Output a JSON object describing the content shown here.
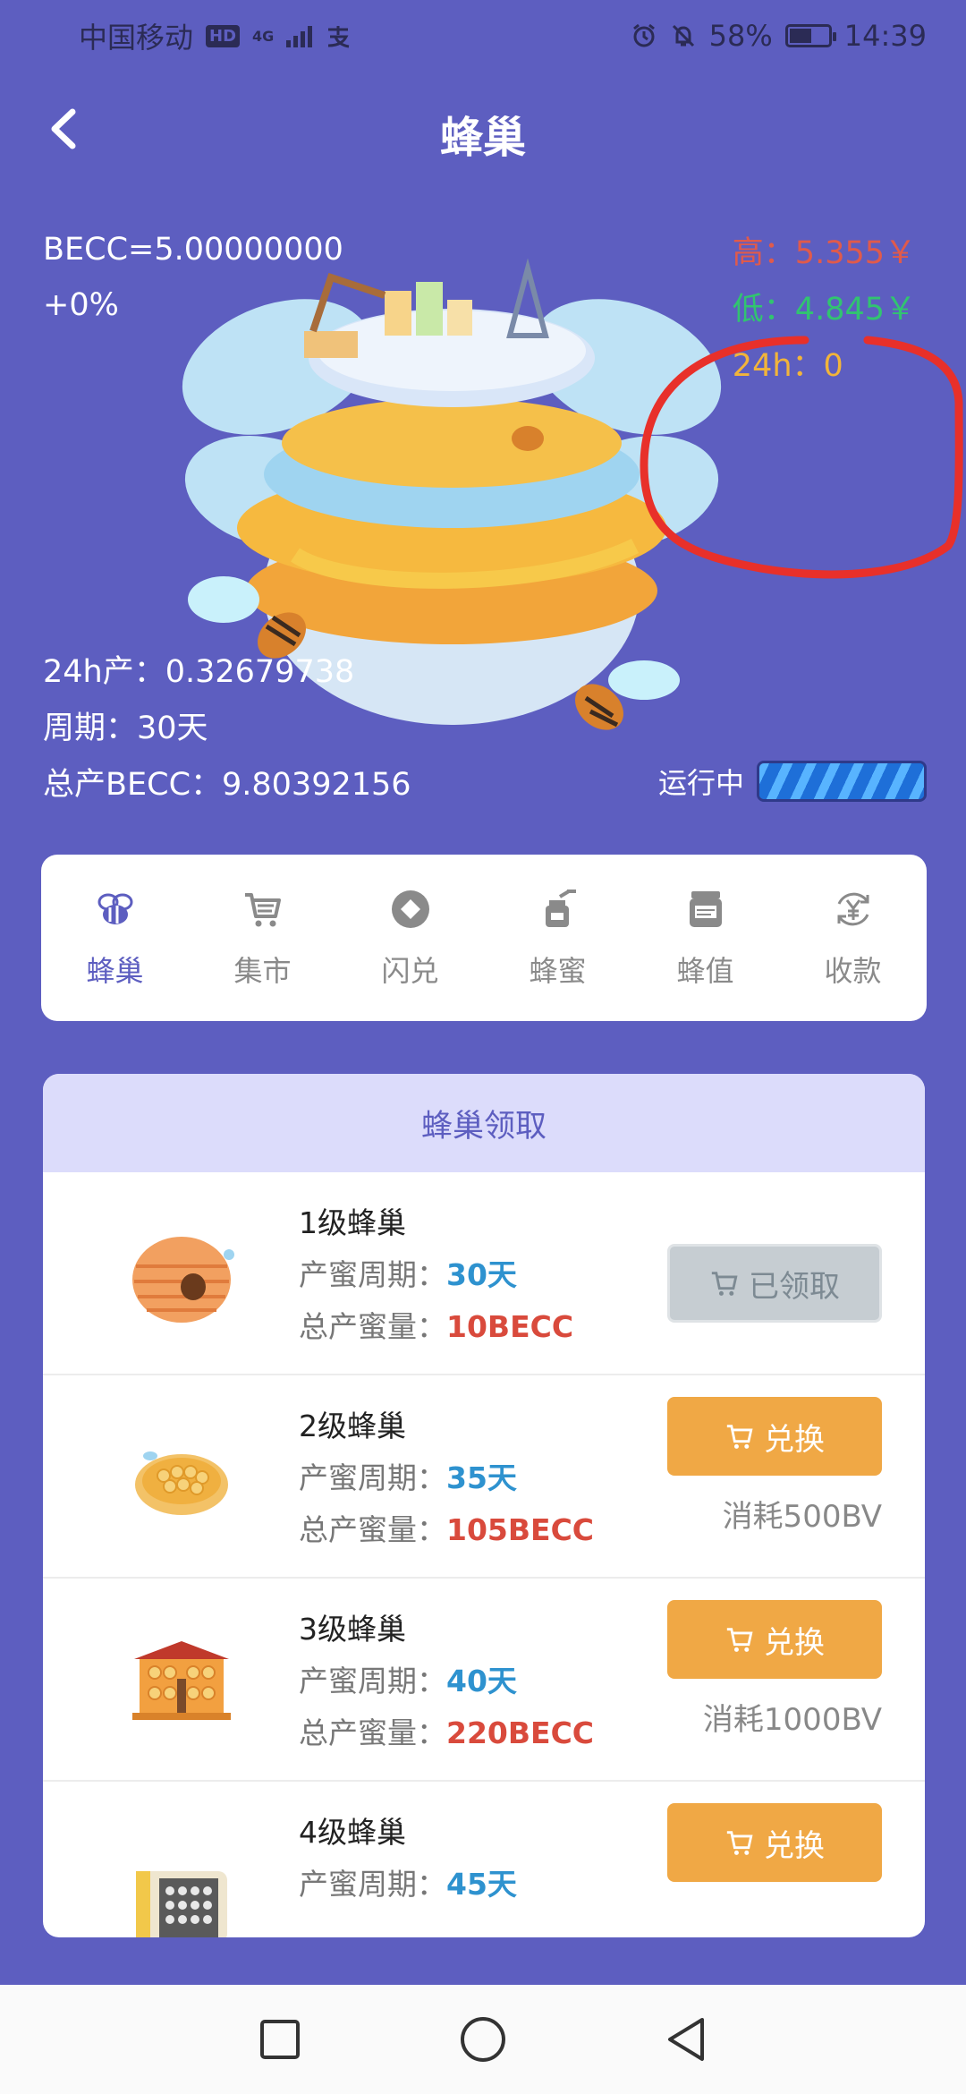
{
  "status_bar": {
    "carrier": "中国移动",
    "hd": "HD",
    "network": "4G",
    "pay_icon": "alipay-icon",
    "battery": "58%",
    "time": "14:39"
  },
  "header": {
    "title": "蜂巢",
    "back_icon": "chevron-left-icon"
  },
  "hero": {
    "price": "BECC=5.00000000",
    "change": "+0%",
    "high": "高：5.355￥",
    "low": "低：4.845￥",
    "volume_24h": "24h：0",
    "production_24h": "24h产：0.32679738",
    "period": "周期：30天",
    "total": "总产BECC：9.80392156",
    "running_label": "运行中",
    "colors": {
      "high": "#e05a4b",
      "low": "#31c470",
      "volume": "#f2b43a",
      "annotation": "#e8302a"
    }
  },
  "nav": {
    "items": [
      {
        "label": "蜂巢",
        "icon": "bee-icon",
        "active": true
      },
      {
        "label": "集市",
        "icon": "cart-icon",
        "active": false
      },
      {
        "label": "闪兑",
        "icon": "swap-icon",
        "active": false
      },
      {
        "label": "蜂蜜",
        "icon": "honey-icon",
        "active": false
      },
      {
        "label": "蜂值",
        "icon": "jar-icon",
        "active": false
      },
      {
        "label": "收款",
        "icon": "yen-icon",
        "active": false
      }
    ]
  },
  "list": {
    "title": "蜂巢领取",
    "cycle_label": "产蜜周期：",
    "total_label": "总产蜜量：",
    "rows": [
      {
        "name": "1级蜂巢",
        "cycle": "30天",
        "total": "10BECC",
        "button": "已领取",
        "button_state": "disabled",
        "cost": ""
      },
      {
        "name": "2级蜂巢",
        "cycle": "35天",
        "total": "105BECC",
        "button": "兑换",
        "button_state": "active",
        "cost": "消耗500BV"
      },
      {
        "name": "3级蜂巢",
        "cycle": "40天",
        "total": "220BECC",
        "button": "兑换",
        "button_state": "active",
        "cost": "消耗1000BV"
      },
      {
        "name": "4级蜂巢",
        "cycle": "45天",
        "total": "",
        "button": "兑换",
        "button_state": "active",
        "cost": ""
      }
    ]
  },
  "system_nav": {
    "items": [
      "square-icon",
      "circle-icon",
      "triangle-back-icon"
    ]
  }
}
